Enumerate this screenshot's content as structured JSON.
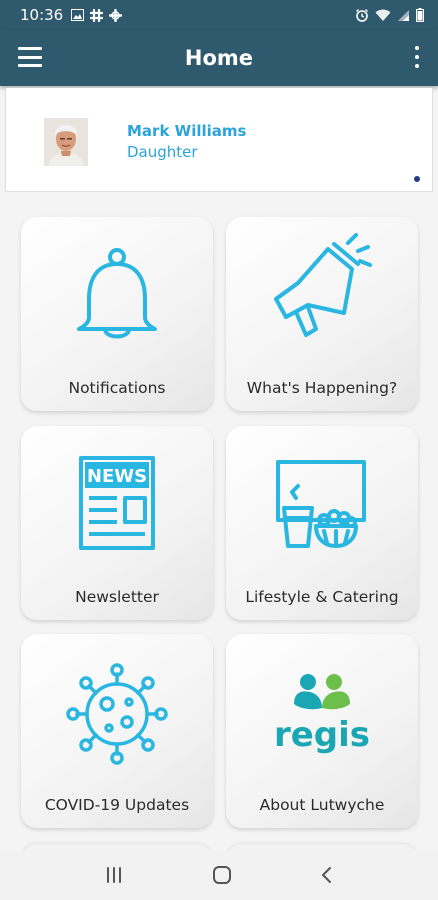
{
  "status_bar": {
    "time": "10:36",
    "left_icons": [
      "gallery-icon",
      "slack-icon",
      "slack-icon"
    ],
    "right_icons": [
      "alarm-icon",
      "wifi-icon",
      "signal-icon",
      "battery-icon"
    ]
  },
  "app_bar": {
    "title": "Home",
    "menu_icon": "hamburger-menu-icon",
    "more_icon": "more-vertical-icon"
  },
  "profile": {
    "name": "Mark Williams",
    "relation": "Daughter"
  },
  "tiles": [
    {
      "label": "Notifications",
      "icon": "bell-icon"
    },
    {
      "label": "What's Happening?",
      "icon": "megaphone-icon"
    },
    {
      "label": "Newsletter",
      "icon": "newspaper-icon"
    },
    {
      "label": "Lifestyle & Catering",
      "icon": "food-drink-icon"
    },
    {
      "label": "COVID-19 Updates",
      "icon": "virus-icon"
    },
    {
      "label": "About Lutwyche",
      "icon": "regis-logo",
      "logo_text": "regis"
    }
  ],
  "colors": {
    "primary": "#2f5a6e",
    "accent": "#2ba4d9",
    "logo_teal": "#1aa7b3",
    "logo_green": "#6cbf4b"
  },
  "nav_bar": [
    "recent-apps-icon",
    "home-icon",
    "back-icon"
  ]
}
